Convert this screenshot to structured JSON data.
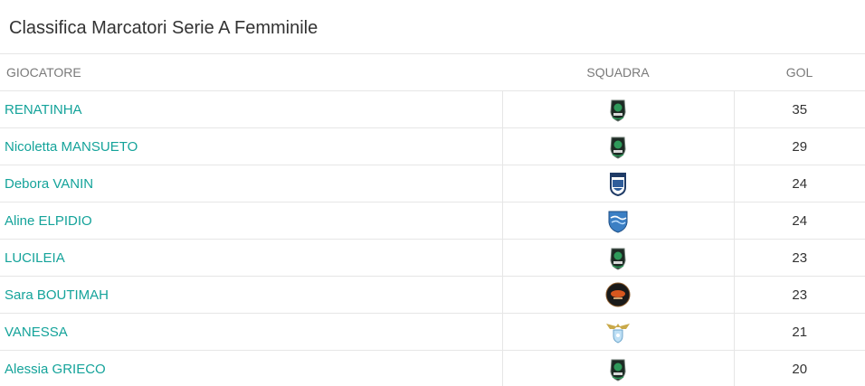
{
  "title": "Classifica Marcatori Serie A Femminile",
  "headers": {
    "player": "GIOCATORE",
    "team": "SQUADRA",
    "goals": "GOL"
  },
  "rows": [
    {
      "player": "RENATINHA",
      "team_icon": "green-black-crest-icon",
      "goals": "35"
    },
    {
      "player": "Nicoletta MANSUETO",
      "team_icon": "green-black-crest-icon",
      "goals": "29"
    },
    {
      "player": "Debora VANIN",
      "team_icon": "cmb-crest-icon",
      "goals": "24"
    },
    {
      "player": "Aline ELPIDIO",
      "team_icon": "blue-wave-shield-icon",
      "goals": "24"
    },
    {
      "player": "LUCILEIA",
      "team_icon": "green-black-crest-icon",
      "goals": "23"
    },
    {
      "player": "Sara BOUTIMAH",
      "team_icon": "orange-black-round-logo-icon",
      "goals": "23"
    },
    {
      "player": "VANESSA",
      "team_icon": "lazio-eagle-icon",
      "goals": "21"
    },
    {
      "player": "Alessia GRIECO",
      "team_icon": "green-black-crest-icon",
      "goals": "20"
    }
  ],
  "colors": {
    "link": "#14a39a",
    "header_text": "#7a7a7a",
    "border": "#e6e6e6"
  }
}
